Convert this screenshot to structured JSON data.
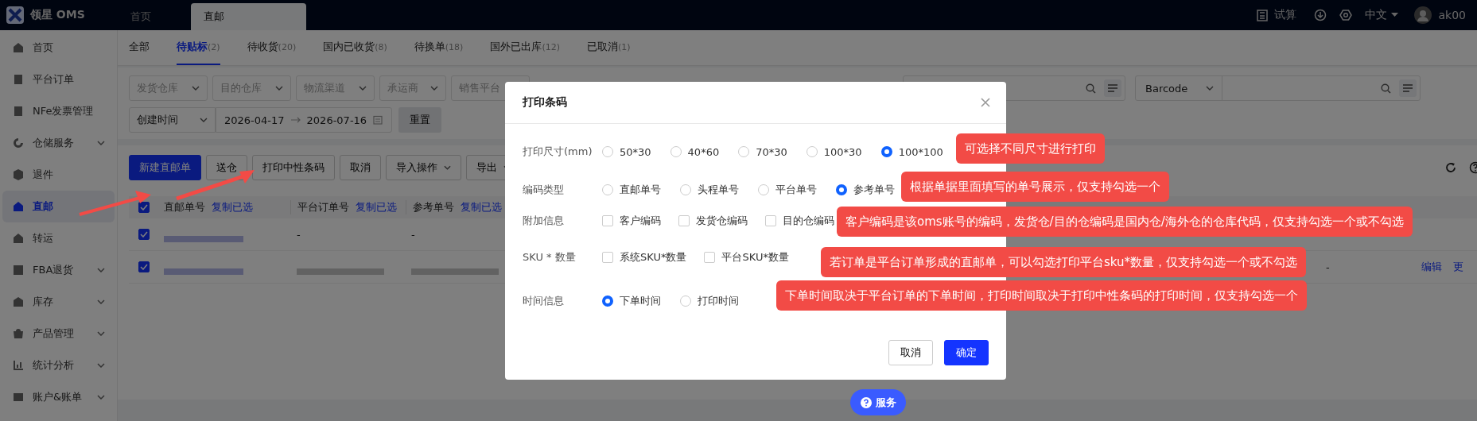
{
  "app": {
    "logo_text": "领星 OMS"
  },
  "top_tabs": [
    {
      "label": "首页",
      "selected": false
    },
    {
      "label": "直邮",
      "selected": true
    }
  ],
  "header_right": {
    "trial": "试算",
    "language": "中文",
    "user": "ak00"
  },
  "sidebar": {
    "items": [
      {
        "label": "首页",
        "expandable": false,
        "selected": false
      },
      {
        "label": "平台订单",
        "expandable": false,
        "selected": false
      },
      {
        "label": "NFe发票管理",
        "expandable": false,
        "selected": false
      },
      {
        "label": "仓储服务",
        "expandable": true,
        "selected": false
      },
      {
        "label": "退件",
        "expandable": false,
        "selected": false
      },
      {
        "label": "直邮",
        "expandable": false,
        "selected": true
      },
      {
        "label": "转运",
        "expandable": false,
        "selected": false
      },
      {
        "label": "FBA退货",
        "expandable": true,
        "selected": false
      },
      {
        "label": "库存",
        "expandable": true,
        "selected": false
      },
      {
        "label": "产品管理",
        "expandable": true,
        "selected": false
      },
      {
        "label": "统计分析",
        "expandable": true,
        "selected": false
      },
      {
        "label": "账户&账单",
        "expandable": true,
        "selected": false
      }
    ]
  },
  "status_tabs": [
    {
      "label": "全部",
      "selected": false
    },
    {
      "label": "待贴标",
      "count": "(2)",
      "selected": true
    },
    {
      "label": "待收货",
      "count": "(20)",
      "selected": false
    },
    {
      "label": "国内已收货",
      "count": "(8)",
      "selected": false
    },
    {
      "label": "待换单",
      "count": "(18)",
      "selected": false
    },
    {
      "label": "国外已出库",
      "count": "(12)",
      "selected": false
    },
    {
      "label": "已取消",
      "count": "(1)",
      "selected": false
    }
  ],
  "filters": {
    "selects": [
      "发货仓库",
      "目的仓库",
      "物流渠道",
      "承运商",
      "销售平台"
    ],
    "search_type": "Barcode",
    "date_type": "创建时间",
    "date_start": "2026-04-17",
    "date_end": "2026-07-16",
    "reset": "重置"
  },
  "actions": [
    {
      "label": "新建直邮单",
      "kind": "primary"
    },
    {
      "label": "送仓",
      "kind": "default"
    },
    {
      "label": "打印中性条码",
      "kind": "default"
    },
    {
      "label": "取消",
      "kind": "default"
    },
    {
      "label": "导入操作",
      "kind": "dropdown"
    },
    {
      "label": "导出",
      "kind": "dropdown"
    }
  ],
  "table": {
    "all_checked": true,
    "columns": [
      {
        "label": "直邮单号",
        "copy": "复制已选"
      },
      {
        "label": "平台订单号",
        "copy": "复制已选"
      },
      {
        "label": "参考单号",
        "copy": "复制已选"
      }
    ],
    "rows": [
      {
        "checked": true,
        "cells": [
          "",
          "-",
          "-"
        ],
        "tail": []
      },
      {
        "checked": true,
        "cells": [
          "",
          "",
          ""
        ],
        "tail": [
          "-",
          "编辑",
          "更"
        ]
      }
    ]
  },
  "dialog": {
    "title": "打印条码",
    "fields": [
      {
        "label": "打印尺寸(mm)",
        "kind": "radio",
        "options": [
          {
            "label": "50*30",
            "selected": false
          },
          {
            "label": "40*60",
            "selected": false
          },
          {
            "label": "70*30",
            "selected": false
          },
          {
            "label": "100*30",
            "selected": false
          },
          {
            "label": "100*100",
            "selected": true
          }
        ]
      },
      {
        "label": "编码类型",
        "kind": "radio",
        "options": [
          {
            "label": "直邮单号",
            "selected": false
          },
          {
            "label": "头程单号",
            "selected": false
          },
          {
            "label": "平台单号",
            "selected": false
          },
          {
            "label": "参考单号",
            "selected": true
          }
        ]
      },
      {
        "label": "附加信息",
        "kind": "checkbox",
        "options": [
          {
            "label": "客户编码",
            "checked": false
          },
          {
            "label": "发货仓编码",
            "checked": false
          },
          {
            "label": "目的仓编码",
            "checked": false
          }
        ]
      },
      {
        "label": "SKU * 数量",
        "kind": "checkbox",
        "options": [
          {
            "label": "系统SKU*数量",
            "checked": false
          },
          {
            "label": "平台SKU*数量",
            "checked": false
          }
        ]
      },
      {
        "label": "时间信息",
        "kind": "radio",
        "options": [
          {
            "label": "下单时间",
            "selected": true
          },
          {
            "label": "打印时间",
            "selected": false
          }
        ]
      }
    ],
    "buttons": [
      {
        "label": "取消",
        "kind": "default"
      },
      {
        "label": "确定",
        "kind": "primary"
      }
    ]
  },
  "annotations": [
    "可选择不同尺寸进行打印",
    "根据单据里面填写的单号展示，仅支持勾选一个",
    "客户编码是该oms账号的编码，发货仓/目的仓编码是国内仓/海外仓的仓库代码，仅支持勾选一个或不勾选",
    "若订单是平台订单形成的直邮单，可以勾选打印平台sku*数量，仅支持勾选一个或不勾选",
    "下单时间取决于平台订单的下单时间，打印时间取决于打印中性条码的打印时间，仅支持勾选一个"
  ],
  "service_button": {
    "label": "服务"
  }
}
